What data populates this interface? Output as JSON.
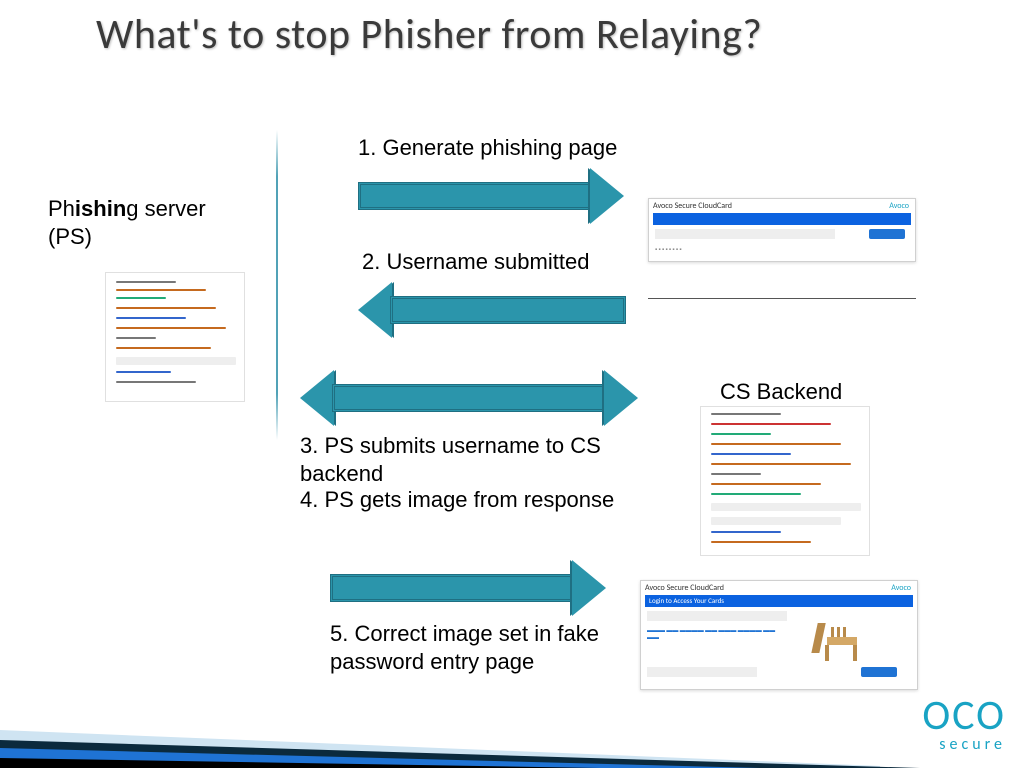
{
  "title": "What's to stop Phisher from Relaying?",
  "ps_label_pre": "Ph",
  "ps_label_bold": "ishin",
  "ps_label_post": "g server (PS)",
  "cs_label": "CS Backend",
  "steps": {
    "s1": "1. Generate phishing page",
    "s2": "2. Username submitted",
    "s3": "3. PS submits username to CS backend",
    "s4": "4. PS gets image from response",
    "s5": "5. Correct image set in fake password entry page"
  },
  "cloudcard_header": "Avoco Secure CloudCard",
  "cloudcard_bar": "Login to Access Your Cards",
  "brand": "Avoco",
  "logo_main": "OCO",
  "logo_sub": "secure"
}
